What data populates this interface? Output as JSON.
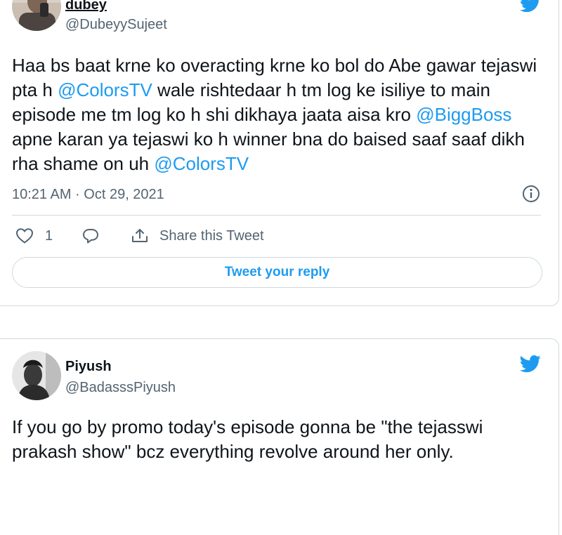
{
  "tweet1": {
    "display_name": "dubey",
    "handle": "@DubeyySujeet",
    "text": [
      {
        "t": "Haa bs baat krne ko overacting krne ko bol do Abe gawar tejaswi pta h ",
        "mention": false
      },
      {
        "t": "@ColorsTV",
        "mention": true
      },
      {
        "t": " wale rishtedaar h tm log ke isiliye to main episode me tm log ko h shi dikhaya jaata aisa kro ",
        "mention": false
      },
      {
        "t": "@BiggBoss",
        "mention": true
      },
      {
        "t": " apne karan ya tejaswi ko h winner bna do baised saaf saaf dikh rha shame on uh  ",
        "mention": false
      },
      {
        "t": "@ColorsTV",
        "mention": true
      }
    ],
    "timestamp": "10:21 AM · Oct 29, 2021",
    "like_count": "1",
    "share_label": "Share this Tweet",
    "reply_button_label": "Tweet your reply"
  },
  "tweet2": {
    "display_name": "Piyush",
    "handle": "@BadasssPiyush",
    "text": [
      {
        "t": "If you go by promo today's episode gonna be \"the tejasswi prakash show\" bcz everything revolve around her only.",
        "mention": false
      }
    ]
  },
  "icons": {
    "brand": "twitter-bird-icon",
    "like": "heart-icon",
    "reply": "speech-bubble-icon",
    "share": "share-upload-icon",
    "info": "info-icon"
  },
  "colors": {
    "accent": "#1d9bf0",
    "text": "#0f1419",
    "secondary": "#536471",
    "border": "#cfd9de"
  }
}
